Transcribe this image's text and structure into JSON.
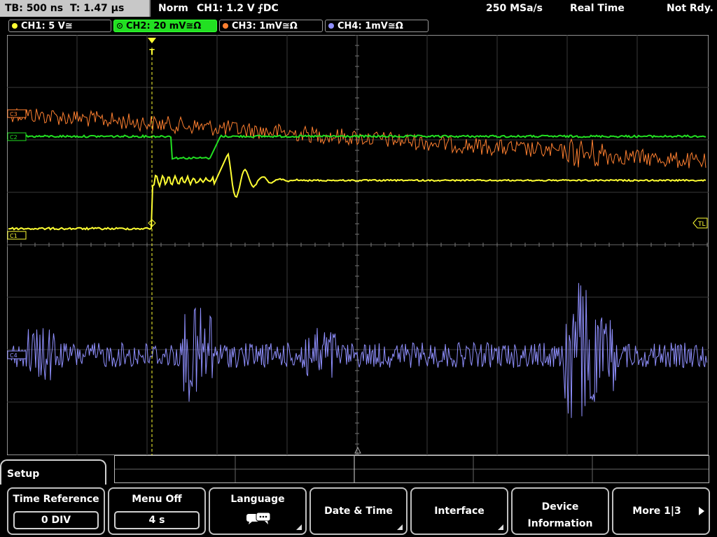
{
  "status": {
    "timebase": "TB: 500 ns",
    "trigger_time": "T: 1.47 µs",
    "trigger_mode": "Norm",
    "trigger_source": "CH1: 1.2 V",
    "trigger_slope": "⨍DC",
    "sample_rate": "250 MSa/s",
    "acq_mode": "Real Time",
    "run_state": "Not Rdy."
  },
  "channels": [
    {
      "id": "ch1",
      "label": "CH1: 5 V≅",
      "color": "#ffff33"
    },
    {
      "id": "ch2",
      "label": "CH2: 20 mV≅Ω",
      "color": "#22e022"
    },
    {
      "id": "ch3",
      "label": "CH3: 1mV≅Ω",
      "color": "#ff8030"
    },
    {
      "id": "ch4",
      "label": "CH4: 1mV≅Ω",
      "color": "#9090ff"
    }
  ],
  "markers": {
    "c3": "C3",
    "c2": "C2",
    "c1": "C1",
    "c4": "C4",
    "trigger_level": "TL",
    "trigger_pos": "T"
  },
  "menu": {
    "title": "Setup",
    "time_reference": {
      "label": "Time Reference",
      "value": "0 DIV"
    },
    "menu_off": {
      "label": "Menu Off",
      "value": "4 s"
    },
    "language": {
      "label": "Language",
      "icon": "speech-bubbles-icon"
    },
    "date_time": {
      "label": "Date & Time"
    },
    "interface": {
      "label": "Interface"
    },
    "device_info": {
      "line1": "Device",
      "line2": "Information"
    },
    "more": {
      "label": "More 1|3"
    }
  }
}
